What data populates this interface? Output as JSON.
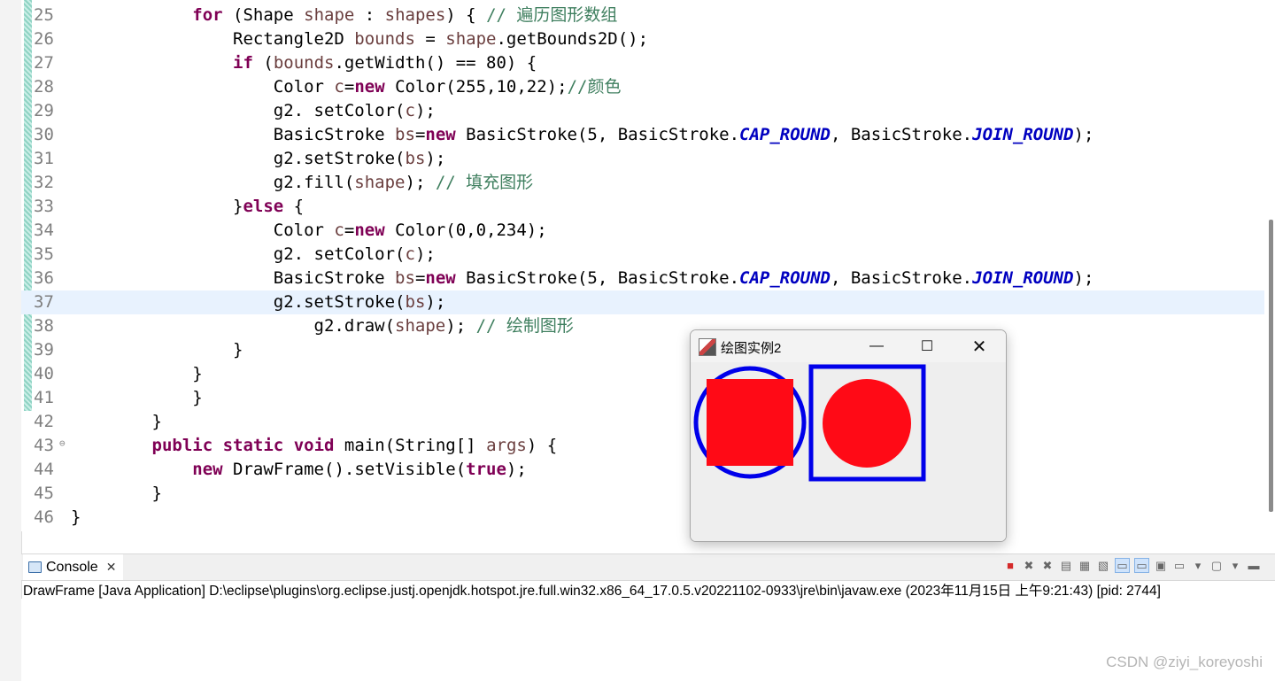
{
  "editor": {
    "lines": [
      {
        "num": "25",
        "tokens": [
          [
            "t",
            "            "
          ],
          [
            "kw",
            "for"
          ],
          [
            "t",
            " (Shape "
          ],
          [
            "var",
            "shape"
          ],
          [
            "t",
            " : "
          ],
          [
            "var",
            "shapes"
          ],
          [
            "t",
            ") { "
          ],
          [
            "cm",
            "// 遍历图形数组"
          ]
        ]
      },
      {
        "num": "26",
        "tokens": [
          [
            "t",
            "                Rectangle2D "
          ],
          [
            "var",
            "bounds"
          ],
          [
            "t",
            " = "
          ],
          [
            "var",
            "shape"
          ],
          [
            "t",
            ".getBounds2D();"
          ]
        ]
      },
      {
        "num": "27",
        "tokens": [
          [
            "t",
            "                "
          ],
          [
            "kw",
            "if"
          ],
          [
            "t",
            " ("
          ],
          [
            "var",
            "bounds"
          ],
          [
            "t",
            ".getWidth() == 80) {"
          ]
        ]
      },
      {
        "num": "28",
        "tokens": [
          [
            "t",
            "                    Color "
          ],
          [
            "var",
            "c"
          ],
          [
            "t",
            "="
          ],
          [
            "kw",
            "new"
          ],
          [
            "t",
            " Color(255,10,22);"
          ],
          [
            "cm",
            "//颜色"
          ]
        ]
      },
      {
        "num": "29",
        "tokens": [
          [
            "t",
            "                    g2. setColor("
          ],
          [
            "var",
            "c"
          ],
          [
            "t",
            ");"
          ]
        ]
      },
      {
        "num": "30",
        "tokens": [
          [
            "t",
            "                    BasicStroke "
          ],
          [
            "var",
            "bs"
          ],
          [
            "t",
            "="
          ],
          [
            "kw",
            "new"
          ],
          [
            "t",
            " BasicStroke(5, BasicStroke."
          ],
          [
            "fld",
            "CAP_ROUND"
          ],
          [
            "t",
            ", BasicStroke."
          ],
          [
            "fld",
            "JOIN_ROUND"
          ],
          [
            "t",
            ");"
          ]
        ]
      },
      {
        "num": "31",
        "tokens": [
          [
            "t",
            "                    g2.setStroke("
          ],
          [
            "var",
            "bs"
          ],
          [
            "t",
            ");"
          ]
        ]
      },
      {
        "num": "32",
        "tokens": [
          [
            "t",
            "                    g2.fill("
          ],
          [
            "var",
            "shape"
          ],
          [
            "t",
            "); "
          ],
          [
            "cm",
            "// 填充图形"
          ]
        ]
      },
      {
        "num": "33",
        "tokens": [
          [
            "t",
            "                }"
          ],
          [
            "kw",
            "else"
          ],
          [
            "t",
            " {"
          ]
        ]
      },
      {
        "num": "34",
        "tokens": [
          [
            "t",
            "                    Color "
          ],
          [
            "var",
            "c"
          ],
          [
            "t",
            "="
          ],
          [
            "kw",
            "new"
          ],
          [
            "t",
            " Color(0,0,234);"
          ]
        ]
      },
      {
        "num": "35",
        "tokens": [
          [
            "t",
            "                    g2. setColor("
          ],
          [
            "var",
            "c"
          ],
          [
            "t",
            ");"
          ]
        ]
      },
      {
        "num": "36",
        "tokens": [
          [
            "t",
            "                    BasicStroke "
          ],
          [
            "var",
            "bs"
          ],
          [
            "t",
            "="
          ],
          [
            "kw",
            "new"
          ],
          [
            "t",
            " BasicStroke(5, BasicStroke."
          ],
          [
            "fld",
            "CAP_ROUND"
          ],
          [
            "t",
            ", BasicStroke."
          ],
          [
            "fld",
            "JOIN_ROUND"
          ],
          [
            "t",
            ");"
          ]
        ]
      },
      {
        "num": "37",
        "tokens": [
          [
            "t",
            "                    g2.setStroke("
          ],
          [
            "var",
            "bs"
          ],
          [
            "t",
            ");"
          ]
        ]
      },
      {
        "num": "38",
        "tokens": [
          [
            "t",
            "                        g2.draw("
          ],
          [
            "var",
            "shape"
          ],
          [
            "t",
            "); "
          ],
          [
            "cm",
            "// 绘制图形"
          ]
        ]
      },
      {
        "num": "39",
        "tokens": [
          [
            "t",
            "                }"
          ]
        ]
      },
      {
        "num": "40",
        "tokens": [
          [
            "t",
            "            }"
          ]
        ]
      },
      {
        "num": "41",
        "tokens": [
          [
            "t",
            "            }"
          ]
        ]
      },
      {
        "num": "42",
        "tokens": [
          [
            "t",
            "        }"
          ]
        ]
      },
      {
        "num": "43",
        "tokens": [
          [
            "t",
            "        "
          ],
          [
            "kw",
            "public"
          ],
          [
            "t",
            " "
          ],
          [
            "kw",
            "static"
          ],
          [
            "t",
            " "
          ],
          [
            "kw",
            "void"
          ],
          [
            "t",
            " main(String[] "
          ],
          [
            "var",
            "args"
          ],
          [
            "t",
            ") {"
          ]
        ]
      },
      {
        "num": "44",
        "tokens": [
          [
            "t",
            "            "
          ],
          [
            "kw",
            "new"
          ],
          [
            "t",
            " DrawFrame().setVisible("
          ],
          [
            "kw",
            "true"
          ],
          [
            "t",
            ");"
          ]
        ]
      },
      {
        "num": "45",
        "tokens": [
          [
            "t",
            "        }"
          ]
        ]
      },
      {
        "num": "46",
        "tokens": [
          [
            "t",
            "}"
          ]
        ]
      }
    ],
    "current_line": "37",
    "fold_line": "43",
    "fold_marker": "⊖"
  },
  "console": {
    "tab_label": "Console",
    "close_glyph": "✕",
    "description": "DrawFrame [Java Application] D:\\eclipse\\plugins\\org.eclipse.justj.openjdk.hotspot.jre.full.win32.x86_64_17.0.5.v20221102-0933\\jre\\bin\\javaw.exe  (2023年11月15日 上午9:21:43) [pid: 2744]",
    "toolbar": [
      "terminate-icon",
      "remove-launch-icon",
      "remove-all-icon",
      "clear-console-icon",
      "scroll-lock-icon",
      "word-wrap-icon",
      "show-on-stdout-icon",
      "show-on-stderr-icon",
      "pin-console-icon",
      "display-console-icon",
      "dropdown-icon",
      "open-console-icon",
      "dropdown-icon",
      "minimize-icon"
    ]
  },
  "window": {
    "title": "绘图实例2",
    "min_glyph": "—",
    "max_glyph": "☐",
    "close_glyph": "✕"
  },
  "drawing": {
    "red": "#ff0a16",
    "blue": "#0000ea",
    "stroke_width": 5
  },
  "watermark": "CSDN @ziyi_koreyoshi"
}
